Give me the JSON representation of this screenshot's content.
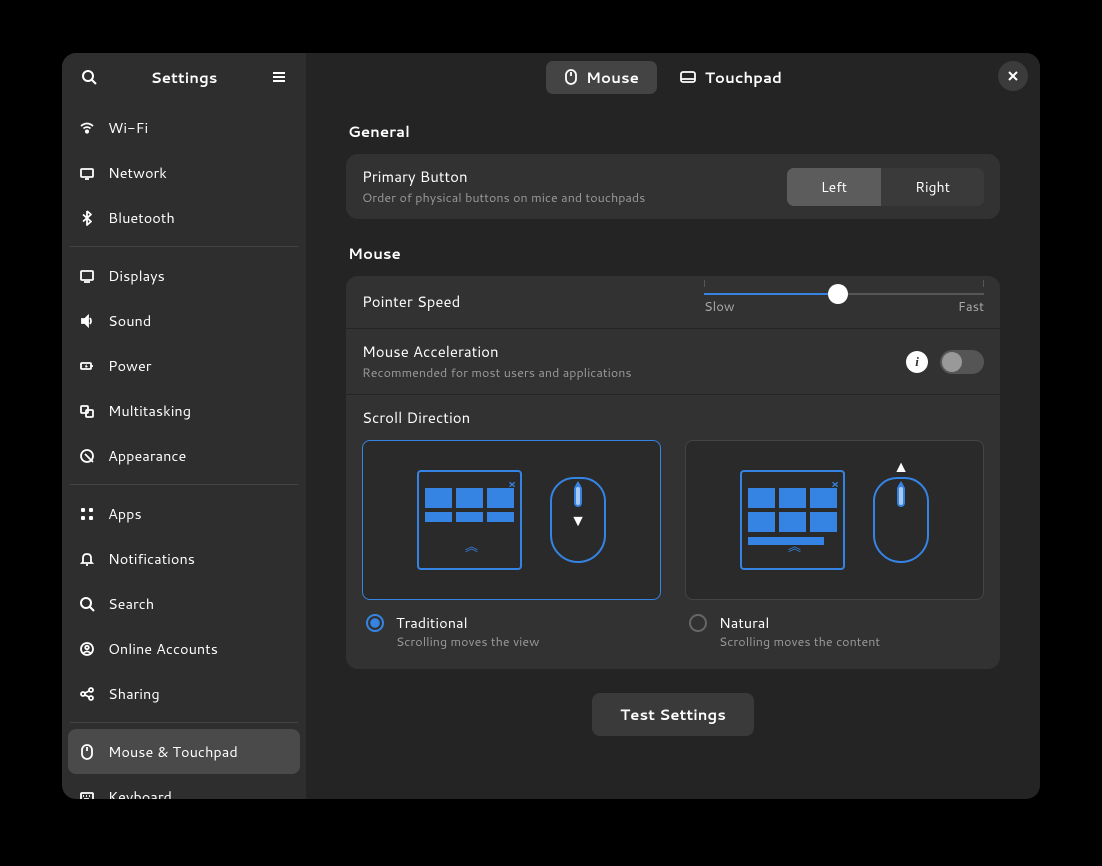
{
  "app_title": "Settings",
  "sidebar": {
    "items": [
      {
        "label": "Wi-Fi"
      },
      {
        "label": "Network"
      },
      {
        "label": "Bluetooth"
      },
      {
        "label": "Displays"
      },
      {
        "label": "Sound"
      },
      {
        "label": "Power"
      },
      {
        "label": "Multitasking"
      },
      {
        "label": "Appearance"
      },
      {
        "label": "Apps"
      },
      {
        "label": "Notifications"
      },
      {
        "label": "Search"
      },
      {
        "label": "Online Accounts"
      },
      {
        "label": "Sharing"
      },
      {
        "label": "Mouse & Touchpad"
      },
      {
        "label": "Keyboard"
      }
    ],
    "selected_index": 13
  },
  "header": {
    "tabs": [
      {
        "label": "Mouse",
        "active": true
      },
      {
        "label": "Touchpad",
        "active": false
      }
    ]
  },
  "sections": {
    "general_title": "General",
    "primary_button": {
      "title": "Primary Button",
      "subtitle": "Order of physical buttons on mice and touchpads",
      "left": "Left",
      "right": "Right",
      "value": "Left"
    },
    "mouse_title": "Mouse",
    "pointer_speed": {
      "title": "Pointer Speed",
      "slow": "Slow",
      "fast": "Fast",
      "value_percent": 48
    },
    "acceleration": {
      "title": "Mouse Acceleration",
      "subtitle": "Recommended for most users and applications",
      "enabled": false
    },
    "scroll": {
      "title": "Scroll Direction",
      "traditional": {
        "label": "Traditional",
        "sub": "Scrolling moves the view"
      },
      "natural": {
        "label": "Natural",
        "sub": "Scrolling moves the content"
      },
      "selected": "traditional"
    },
    "test_button": "Test Settings"
  },
  "colors": {
    "accent": "#3584e4"
  }
}
